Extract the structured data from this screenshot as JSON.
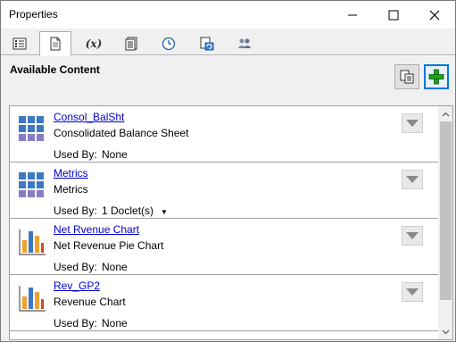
{
  "window": {
    "title": "Properties"
  },
  "tabs": [
    {
      "icon": "list-properties-icon"
    },
    {
      "icon": "document-icon",
      "active": true
    },
    {
      "label": "(x)",
      "icon": "variable-icon"
    },
    {
      "icon": "report-icon"
    },
    {
      "icon": "clock-icon"
    },
    {
      "icon": "refresh-document-icon"
    },
    {
      "icon": "users-icon"
    }
  ],
  "content": {
    "heading": "Available Content",
    "items": [
      {
        "name": "Consol_BalSht",
        "description": "Consolidated Balance Sheet",
        "used_by_label": "Used By:",
        "used_by_value": "None",
        "icon": "grid-icon"
      },
      {
        "name": "Metrics",
        "description": "Metrics",
        "used_by_label": "Used By:",
        "used_by_value": "1 Doclet(s)",
        "used_by_caret": "▼",
        "icon": "grid-icon"
      },
      {
        "name": "Net Rvenue Chart",
        "description": "Net Revenue Pie Chart",
        "used_by_label": "Used By:",
        "used_by_value": "None",
        "icon": "bar-chart-icon"
      },
      {
        "name": "Rev_GP2",
        "description": "Revenue Chart",
        "used_by_label": "Used By:",
        "used_by_value": "None",
        "icon": "bar-chart-icon"
      }
    ]
  },
  "colors": {
    "accent": "#0078d7",
    "link": "#0000cc",
    "add_green": "#1e9e1e"
  }
}
